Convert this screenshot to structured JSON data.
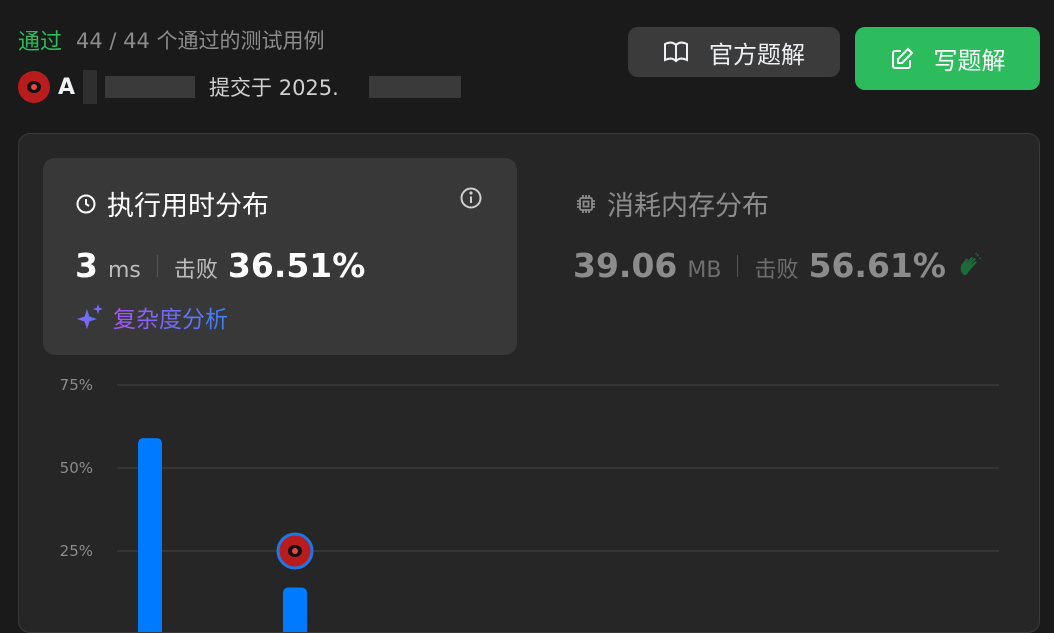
{
  "status": {
    "accepted": "通过",
    "count": "44 / 44 个通过的测试用例"
  },
  "user": {
    "initial": "A",
    "submitted": "提交于 2025."
  },
  "buttons": {
    "official": "官方题解",
    "write": "写题解"
  },
  "runtime": {
    "title": "执行用时分布",
    "value": "3",
    "unit": "ms",
    "beat_label": "击败",
    "beat_value": "36.51%",
    "complexity": "复杂度分析"
  },
  "memory": {
    "title": "消耗内存分布",
    "value": "39.06",
    "unit": "MB",
    "beat_label": "击败",
    "beat_value": "56.61%"
  },
  "colors": {
    "accent_green": "#2cbb5d",
    "bar_blue": "#007aff",
    "panel_bg": "#262626",
    "card_bg": "#383838"
  },
  "chart_data": {
    "type": "bar",
    "ytick_labels": [
      "75%",
      "50%",
      "25%"
    ],
    "yticks": [
      75,
      50,
      25
    ],
    "ylim": [
      0,
      75
    ],
    "bars": [
      {
        "x": 0,
        "value": 59
      },
      {
        "x": 1,
        "value": 14
      }
    ],
    "marker_bar": 1,
    "marker_value": 25
  }
}
